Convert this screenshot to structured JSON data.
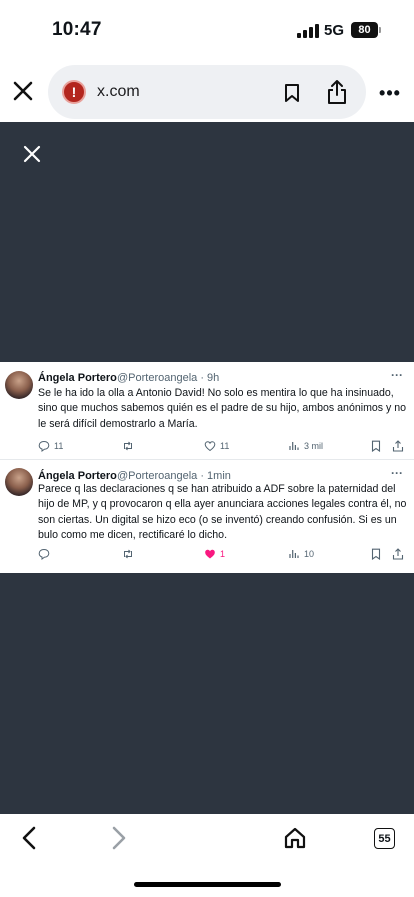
{
  "status_bar": {
    "time": "10:47",
    "network": "5G",
    "battery": "80"
  },
  "browser": {
    "url": "x.com",
    "tab_count": "55",
    "icons": [
      "close-icon",
      "alert-icon",
      "bookmark-icon",
      "share-icon",
      "more-icon",
      "back-icon",
      "forward-icon",
      "home-icon",
      "tabs-icon"
    ]
  },
  "tweets": [
    {
      "author": "Ángela Portero",
      "handle_time": "@Porteroangela · 9h",
      "text": "Se le ha ido la olla a Antonio David! No solo es mentira lo que ha insinuado, sino que muchos sabemos quién es el padre de su hijo, ambos anónimos y no le será difícil demostrarlo a María.",
      "replies": "11",
      "retweets": "",
      "likes": "11",
      "views": "3 mil"
    },
    {
      "author": "Ángela Portero",
      "handle_time": "@Porteroangela · 1min",
      "text": "Parece q las declaraciones q se han atribuido a ADF sobre la paternidad del hijo de MP, y q provocaron q ella ayer anunciara acciones legales contra él, no son ciertas. Un digital se hizo eco (o se inventó) creando confusión. Si es un bulo como me dicen, rectificaré lo dicho.",
      "replies": "",
      "retweets": "",
      "likes": "1",
      "views": "10"
    }
  ],
  "colors": {
    "overlay": "#2d3540",
    "like_active": "#f91880",
    "muted": "#536471"
  }
}
